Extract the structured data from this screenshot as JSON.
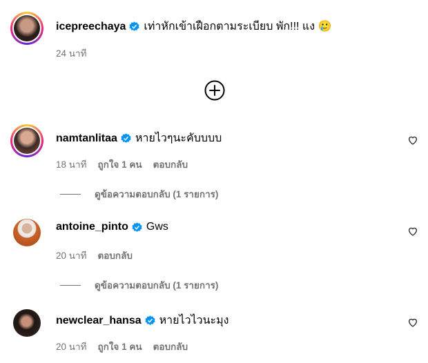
{
  "caption": {
    "username": "icepreechaya",
    "text": "เท่าหักเข้าเฝือกตามระเบียบ พัก!!! แง 🥲",
    "time": "24 นาที",
    "avatar_color": "#3a2a25"
  },
  "load_more_icon": "plus-circle-icon",
  "comments": [
    {
      "username": "namtanlitaa",
      "text": "หายไวๆนะคับบบบ",
      "time": "18 นาที",
      "likes": "ถูกใจ 1 คน",
      "reply_label": "ตอบกลับ",
      "view_replies": "ดูข้อความตอบกลับ (1 รายการ)"
    },
    {
      "username": "antoine_pinto",
      "text": "Gws",
      "time": "20 นาที",
      "reply_label": "ตอบกลับ",
      "view_replies": "ดูข้อความตอบกลับ (1 รายการ)"
    },
    {
      "username": "newclear_hansa",
      "text": "หายไวไวนะมุง",
      "time": "20 นาที",
      "likes": "ถูกใจ 1 คน",
      "reply_label": "ตอบกลับ"
    }
  ],
  "colors": {
    "verified": "#0095f6",
    "muted": "#737373"
  }
}
